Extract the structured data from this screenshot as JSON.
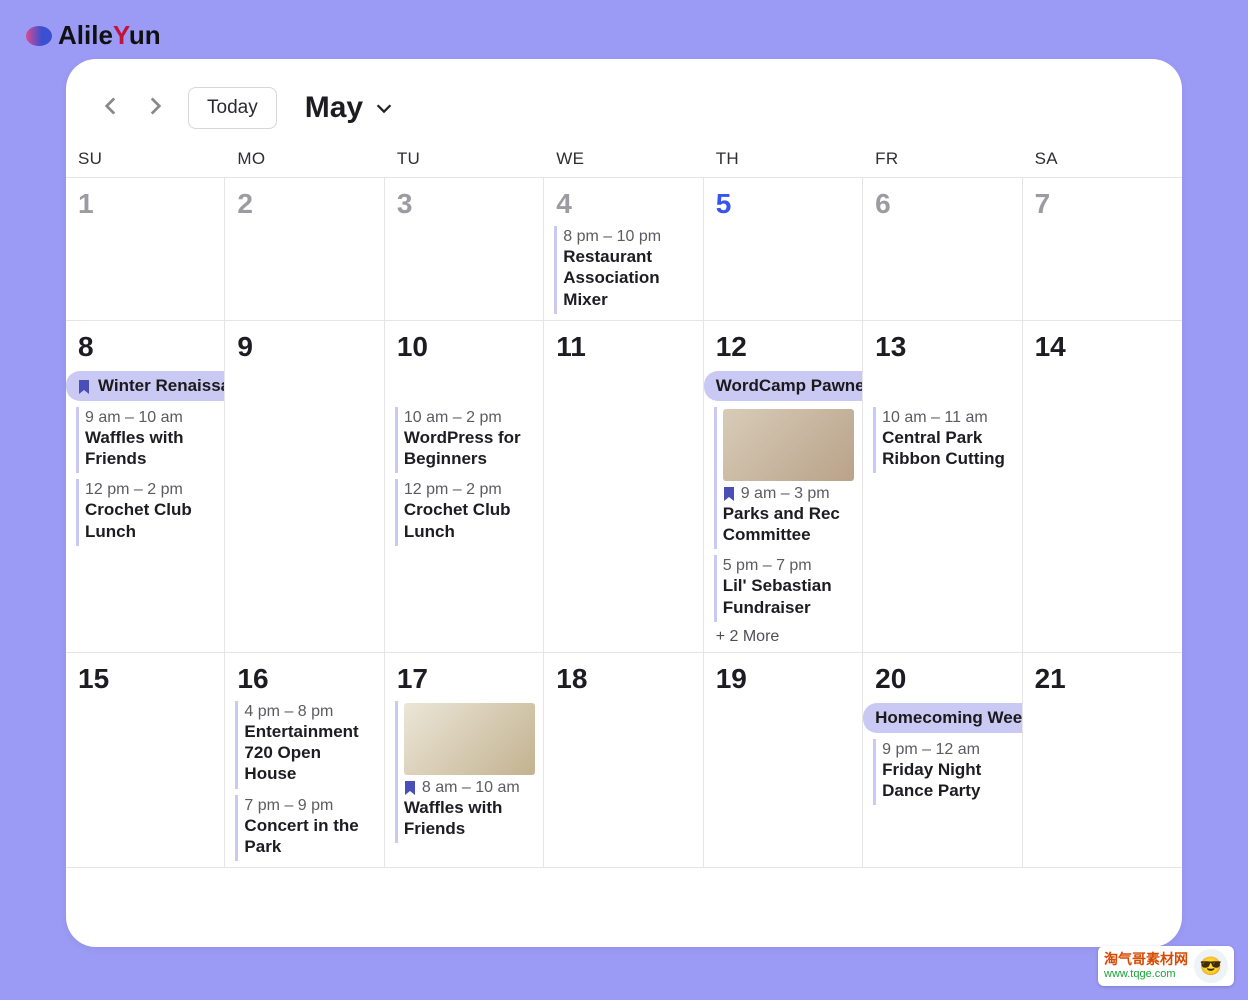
{
  "brand": {
    "name_pre": "Alile",
    "name_y": "Y",
    "name_post": "un"
  },
  "toolbar": {
    "today_label": "Today",
    "month_label": "May"
  },
  "dow": [
    "SU",
    "MO",
    "TU",
    "WE",
    "TH",
    "FR",
    "SA"
  ],
  "weeks": [
    [
      {
        "n": "1"
      },
      {
        "n": "2"
      },
      {
        "n": "3"
      },
      {
        "n": "4",
        "events": [
          {
            "time": "8 pm – 10 pm",
            "title": "Restaurant Association Mixer"
          }
        ]
      },
      {
        "n": "5",
        "today": true
      },
      {
        "n": "6"
      },
      {
        "n": "7"
      }
    ],
    [
      {
        "n": "8",
        "active": true,
        "banner": {
          "text": "Winter Renaissance Fair",
          "span": 3,
          "bookmark": true
        },
        "events": [
          {
            "time": "9 am – 10 am",
            "title": "Waffles with Friends"
          },
          {
            "time": "12 pm – 2 pm",
            "title": "Crochet Club Lunch"
          }
        ]
      },
      {
        "n": "9",
        "active": true
      },
      {
        "n": "10",
        "active": true,
        "events": [
          {
            "time": "10 am – 2 pm",
            "title": "WordPress for Beginners"
          },
          {
            "time": "12 pm – 2 pm",
            "title": "Crochet Club Lunch"
          }
        ]
      },
      {
        "n": "11",
        "active": true
      },
      {
        "n": "12",
        "active": true,
        "banner": {
          "text": "WordCamp Pawnee",
          "span": 2,
          "bookmark": false
        },
        "events": [
          {
            "img": "people",
            "bookmark": true,
            "time": "9 am – 3 pm",
            "title": "Parks and Rec Committee"
          },
          {
            "time": "5 pm – 7 pm",
            "title": "Lil' Sebastian Fundraiser"
          }
        ],
        "more": "+ 2 More"
      },
      {
        "n": "13",
        "active": true,
        "events": [
          {
            "time": "10 am – 11 am",
            "title": "Central Park Ribbon Cutting"
          }
        ]
      },
      {
        "n": "14",
        "active": true
      }
    ],
    [
      {
        "n": "15",
        "active": true
      },
      {
        "n": "16",
        "active": true,
        "events": [
          {
            "time": "4 pm – 8 pm",
            "title": "Entertainment 720 Open House"
          },
          {
            "time": "7 pm – 9 pm",
            "title": "Concert in the Park"
          }
        ]
      },
      {
        "n": "17",
        "active": true,
        "events": [
          {
            "img": "waffle",
            "bookmark": true,
            "time": "8 am – 10 am",
            "title": "Waffles with Friends"
          }
        ]
      },
      {
        "n": "18",
        "active": true
      },
      {
        "n": "19",
        "active": true
      },
      {
        "n": "20",
        "active": true,
        "banner": {
          "text": "Homecoming Weekend",
          "span": 2,
          "bookmark": false,
          "roundRight": true
        },
        "events": [
          {
            "time": "9 pm – 12 am",
            "title": "Friday Night Dance Party"
          }
        ]
      },
      {
        "n": "21",
        "active": true
      }
    ]
  ],
  "watermark": {
    "cn": "淘气哥素材网",
    "url": "www.tqge.com"
  }
}
